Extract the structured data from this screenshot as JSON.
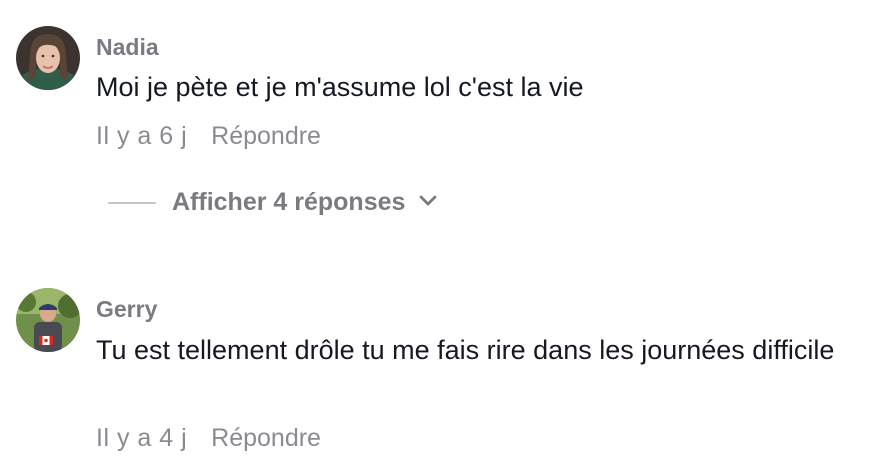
{
  "comments": [
    {
      "username": "Nadia",
      "text": "Moi je pète et je m'assume lol c'est la vie",
      "time": "Il y a 6 j",
      "reply_label": "Répondre",
      "view_replies": "Afficher 4 réponses"
    },
    {
      "username": "Gerry",
      "text": "Tu est tellement drôle tu me fais rire dans les journées difficile",
      "time": "Il y a 4 j",
      "reply_label": "Répondre"
    }
  ],
  "icons": {
    "chevron": "chevron-down-icon"
  },
  "colors": {
    "username": "#7a7b80",
    "body_text": "#161823",
    "meta": "#8a8b91",
    "divider": "#c5c6ca"
  }
}
